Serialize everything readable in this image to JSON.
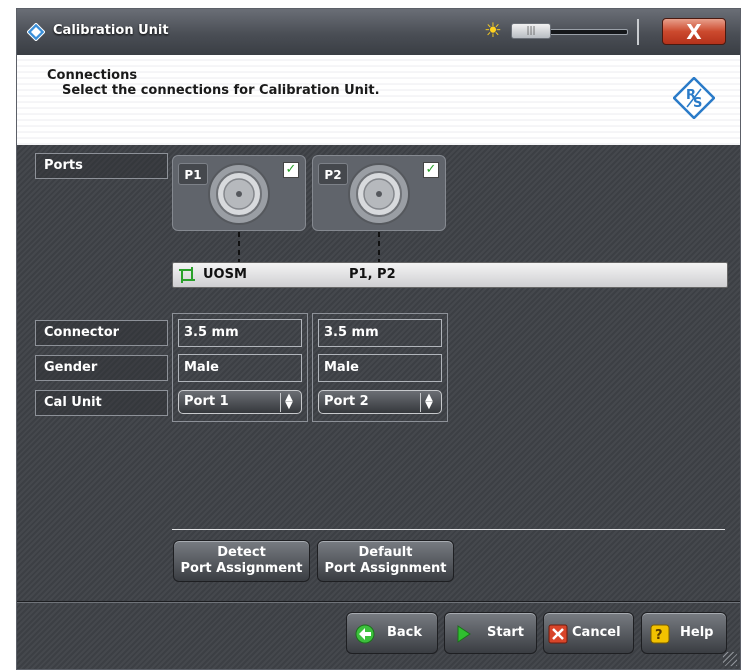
{
  "window": {
    "title": "Calibration Unit",
    "close_label": "X",
    "brightness_slider_grip": "|||"
  },
  "header": {
    "title": "Connections",
    "subtitle": "Select the connections for Calibration Unit."
  },
  "ports_label": "Ports",
  "ports": [
    {
      "name": "P1",
      "checked": true
    },
    {
      "name": "P2",
      "checked": true
    }
  ],
  "cal_unit_row": {
    "name": "UOSM",
    "ports": "P1, P2"
  },
  "row_labels": {
    "connector": "Connector",
    "gender": "Gender",
    "cal_unit": "Cal Unit"
  },
  "columns": [
    {
      "connector": "3.5 mm",
      "gender": "Male",
      "cal_unit": "Port 1"
    },
    {
      "connector": "3.5 mm",
      "gender": "Male",
      "cal_unit": "Port 2"
    }
  ],
  "assignment_buttons": {
    "detect_line1": "Detect",
    "detect_line2": "Port Assignment",
    "default_line1": "Default",
    "default_line2": "Port Assignment"
  },
  "footer": {
    "back": "Back",
    "start": "Start",
    "cancel": "Cancel",
    "help": "Help"
  },
  "colors": {
    "accent_blue": "#2a7bc8",
    "check_green": "#2aa12a",
    "close_red": "#cc4a2e",
    "start_green": "#2fbf2f"
  },
  "icons": {
    "app": "rs-diamond-icon",
    "brightness": "sun-icon",
    "port_connector": "coax-connector-icon",
    "cal_unit": "calibration-unit-icon",
    "back": "arrow-left-icon",
    "start": "play-icon",
    "cancel": "x-icon",
    "help": "question-icon"
  }
}
